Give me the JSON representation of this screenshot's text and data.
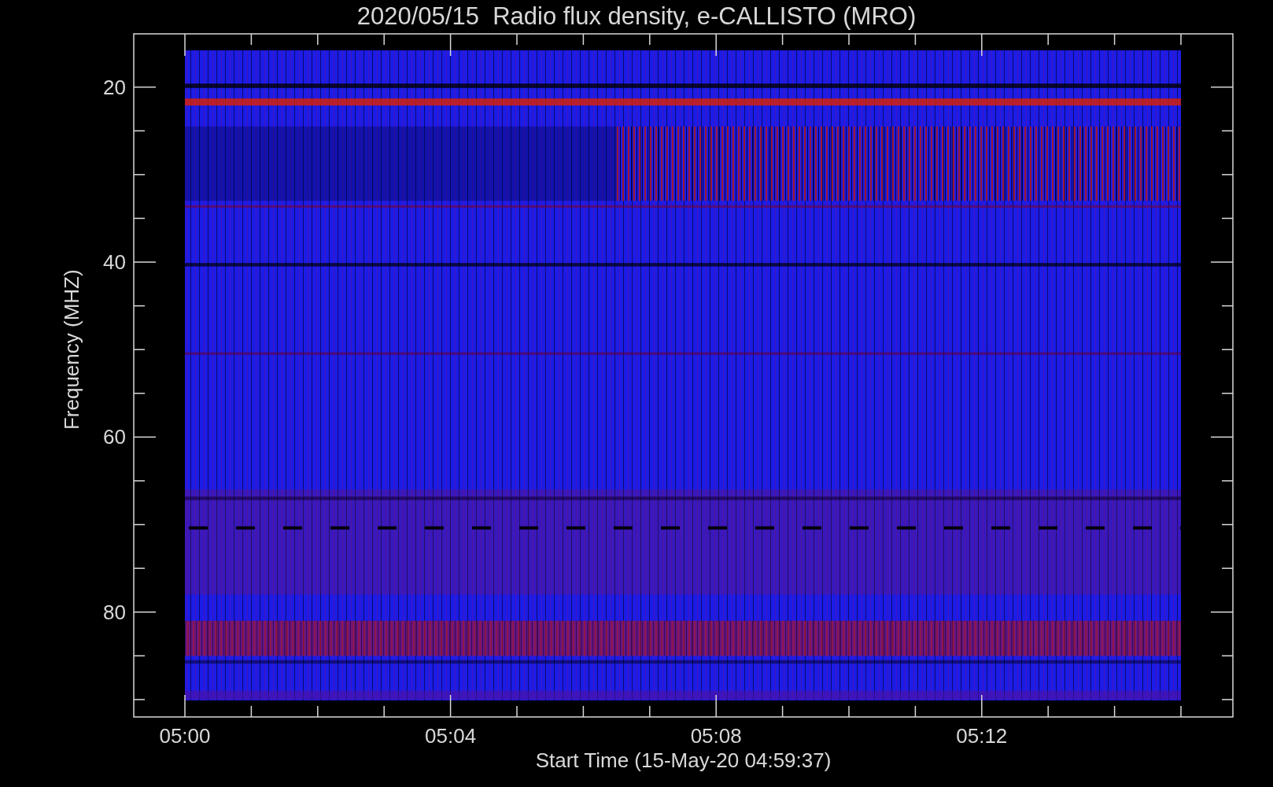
{
  "title": "2020/05/15  Radio flux density, e-CALLISTO (MRO)",
  "y_axis": {
    "label": "Frequency (MHZ)",
    "ticks": [
      "20",
      "40",
      "60",
      "80"
    ]
  },
  "x_axis": {
    "label": "Start Time (15-May-20 04:59:37)",
    "ticks": [
      "05:00",
      "05:04",
      "05:08",
      "05:12"
    ]
  }
}
